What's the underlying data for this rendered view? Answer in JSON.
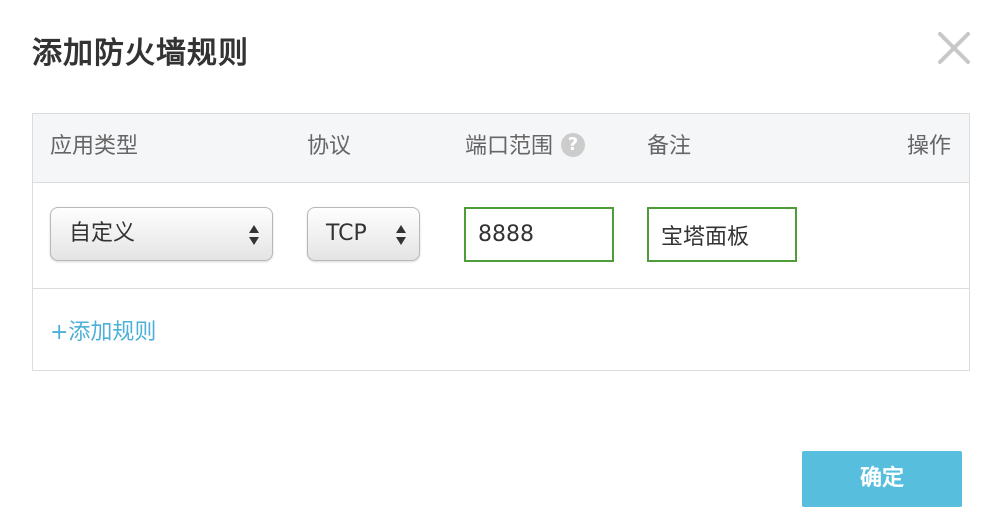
{
  "dialog": {
    "title": "添加防火墙规则",
    "close_icon": "close-icon"
  },
  "table": {
    "headers": {
      "app_type": "应用类型",
      "protocol": "协议",
      "port_range": "端口范围",
      "port_help": "?",
      "note": "备注",
      "action": "操作"
    },
    "rows": [
      {
        "app_type": "自定义",
        "protocol": "TCP",
        "port": "8888",
        "note": "宝塔面板"
      }
    ]
  },
  "add_rule_label": "+添加规则",
  "confirm_label": "确定",
  "colors": {
    "accent": "#57bfdd",
    "link": "#4cb0d8",
    "input_border": "#4f9d3a",
    "header_bg": "#f5f6f8"
  }
}
